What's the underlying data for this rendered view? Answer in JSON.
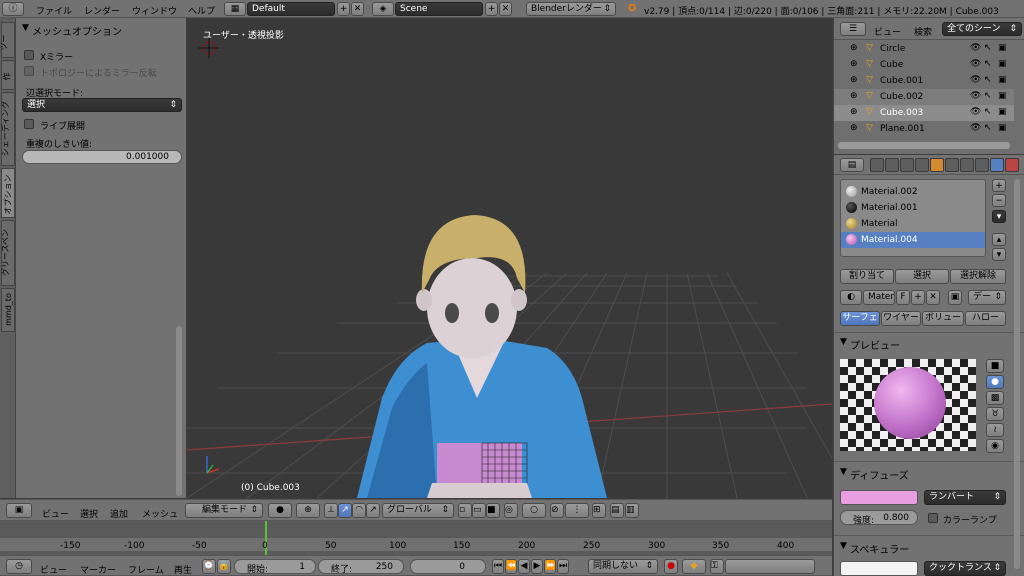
{
  "top_menu": {
    "items": [
      "ファイル",
      "レンダー",
      "ウィンドウ",
      "ヘルプ"
    ],
    "layout_value": "Default",
    "scene_value": "Scene",
    "render_engine": "Blenderレンダー",
    "stats": "v2.79 | 頂点:0/114 | 辺:0/220 | 面:0/106 | 三角面:211 | メモリ:22.20M | Cube.003"
  },
  "left_tabs": [
    "ツー",
    "作",
    "シェーディング",
    "オプション",
    "グリースペン",
    "mmd_to"
  ],
  "tool_panel": {
    "header": "メッシュオプション",
    "x_mirror": "Xミラー",
    "topology_mirror": "トポロジーによるミラー反転",
    "edge_select_label": "辺選択モード:",
    "edge_select_value": "選択",
    "live_unwrap": "ライブ展開",
    "double_threshold_label": "重複のしきい値:",
    "double_threshold_value": "0.001000"
  },
  "viewport": {
    "view_label": "ユーザー・透視投影",
    "object_label": "(0) Cube.003"
  },
  "viewport_header": {
    "menus": [
      "ビュー",
      "選択",
      "追加",
      "メッシュ"
    ],
    "mode": "編集モード",
    "orientation": "グローバル"
  },
  "timeline": {
    "ruler": [
      "-150",
      "-100",
      "-50",
      "0",
      "50",
      "100",
      "150",
      "200",
      "250",
      "300",
      "350",
      "400"
    ],
    "menus": [
      "ビュー",
      "マーカー",
      "フレーム",
      "再生"
    ],
    "start_label": "開始:",
    "start_value": "1",
    "end_label": "終了:",
    "end_value": "250",
    "current_frame": "0",
    "sync": "同期しない"
  },
  "outliner": {
    "header_view": "ビュー",
    "header_search": "検索",
    "header_scope": "全てのシーン",
    "items": [
      "Circle",
      "Cube",
      "Cube.001",
      "Cube.002",
      "Cube.003",
      "Plane.001"
    ]
  },
  "properties": {
    "materials": [
      "Material.002",
      "Material.001",
      "Material",
      "Material.004"
    ],
    "assign": "割り当て",
    "select": "選択",
    "deselect": "選択解除",
    "mat_name": "Materi",
    "fake_user": "F",
    "data_btn": "デー",
    "tabs": [
      "サーフェ",
      "ワイヤー",
      "ボリュー",
      "ハロー"
    ],
    "preview_header": "プレビュー",
    "diffuse_header": "ディフューズ",
    "diffuse_shader": "ランバート",
    "intensity_label": "強度:",
    "intensity_value": "0.800",
    "ramp": "カラーランプ",
    "specular_header": "スペキュラー",
    "specular_shader": "クックトランス"
  },
  "colors": {
    "diffuse": "#e89ee0",
    "selected": "#5680c2",
    "viewport_bg": "#393939"
  }
}
